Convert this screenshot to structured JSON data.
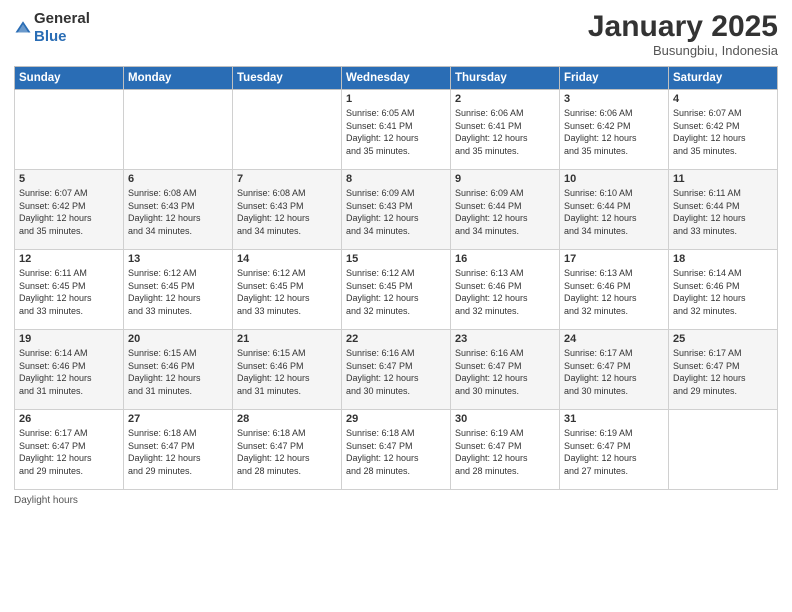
{
  "header": {
    "logo_general": "General",
    "logo_blue": "Blue",
    "month_title": "January 2025",
    "subtitle": "Busungbiu, Indonesia"
  },
  "columns": [
    "Sunday",
    "Monday",
    "Tuesday",
    "Wednesday",
    "Thursday",
    "Friday",
    "Saturday"
  ],
  "weeks": [
    [
      {
        "day": "",
        "info": ""
      },
      {
        "day": "",
        "info": ""
      },
      {
        "day": "",
        "info": ""
      },
      {
        "day": "1",
        "info": "Sunrise: 6:05 AM\nSunset: 6:41 PM\nDaylight: 12 hours\nand 35 minutes."
      },
      {
        "day": "2",
        "info": "Sunrise: 6:06 AM\nSunset: 6:41 PM\nDaylight: 12 hours\nand 35 minutes."
      },
      {
        "day": "3",
        "info": "Sunrise: 6:06 AM\nSunset: 6:42 PM\nDaylight: 12 hours\nand 35 minutes."
      },
      {
        "day": "4",
        "info": "Sunrise: 6:07 AM\nSunset: 6:42 PM\nDaylight: 12 hours\nand 35 minutes."
      }
    ],
    [
      {
        "day": "5",
        "info": "Sunrise: 6:07 AM\nSunset: 6:42 PM\nDaylight: 12 hours\nand 35 minutes."
      },
      {
        "day": "6",
        "info": "Sunrise: 6:08 AM\nSunset: 6:43 PM\nDaylight: 12 hours\nand 34 minutes."
      },
      {
        "day": "7",
        "info": "Sunrise: 6:08 AM\nSunset: 6:43 PM\nDaylight: 12 hours\nand 34 minutes."
      },
      {
        "day": "8",
        "info": "Sunrise: 6:09 AM\nSunset: 6:43 PM\nDaylight: 12 hours\nand 34 minutes."
      },
      {
        "day": "9",
        "info": "Sunrise: 6:09 AM\nSunset: 6:44 PM\nDaylight: 12 hours\nand 34 minutes."
      },
      {
        "day": "10",
        "info": "Sunrise: 6:10 AM\nSunset: 6:44 PM\nDaylight: 12 hours\nand 34 minutes."
      },
      {
        "day": "11",
        "info": "Sunrise: 6:11 AM\nSunset: 6:44 PM\nDaylight: 12 hours\nand 33 minutes."
      }
    ],
    [
      {
        "day": "12",
        "info": "Sunrise: 6:11 AM\nSunset: 6:45 PM\nDaylight: 12 hours\nand 33 minutes."
      },
      {
        "day": "13",
        "info": "Sunrise: 6:12 AM\nSunset: 6:45 PM\nDaylight: 12 hours\nand 33 minutes."
      },
      {
        "day": "14",
        "info": "Sunrise: 6:12 AM\nSunset: 6:45 PM\nDaylight: 12 hours\nand 33 minutes."
      },
      {
        "day": "15",
        "info": "Sunrise: 6:12 AM\nSunset: 6:45 PM\nDaylight: 12 hours\nand 32 minutes."
      },
      {
        "day": "16",
        "info": "Sunrise: 6:13 AM\nSunset: 6:46 PM\nDaylight: 12 hours\nand 32 minutes."
      },
      {
        "day": "17",
        "info": "Sunrise: 6:13 AM\nSunset: 6:46 PM\nDaylight: 12 hours\nand 32 minutes."
      },
      {
        "day": "18",
        "info": "Sunrise: 6:14 AM\nSunset: 6:46 PM\nDaylight: 12 hours\nand 32 minutes."
      }
    ],
    [
      {
        "day": "19",
        "info": "Sunrise: 6:14 AM\nSunset: 6:46 PM\nDaylight: 12 hours\nand 31 minutes."
      },
      {
        "day": "20",
        "info": "Sunrise: 6:15 AM\nSunset: 6:46 PM\nDaylight: 12 hours\nand 31 minutes."
      },
      {
        "day": "21",
        "info": "Sunrise: 6:15 AM\nSunset: 6:46 PM\nDaylight: 12 hours\nand 31 minutes."
      },
      {
        "day": "22",
        "info": "Sunrise: 6:16 AM\nSunset: 6:47 PM\nDaylight: 12 hours\nand 30 minutes."
      },
      {
        "day": "23",
        "info": "Sunrise: 6:16 AM\nSunset: 6:47 PM\nDaylight: 12 hours\nand 30 minutes."
      },
      {
        "day": "24",
        "info": "Sunrise: 6:17 AM\nSunset: 6:47 PM\nDaylight: 12 hours\nand 30 minutes."
      },
      {
        "day": "25",
        "info": "Sunrise: 6:17 AM\nSunset: 6:47 PM\nDaylight: 12 hours\nand 29 minutes."
      }
    ],
    [
      {
        "day": "26",
        "info": "Sunrise: 6:17 AM\nSunset: 6:47 PM\nDaylight: 12 hours\nand 29 minutes."
      },
      {
        "day": "27",
        "info": "Sunrise: 6:18 AM\nSunset: 6:47 PM\nDaylight: 12 hours\nand 29 minutes."
      },
      {
        "day": "28",
        "info": "Sunrise: 6:18 AM\nSunset: 6:47 PM\nDaylight: 12 hours\nand 28 minutes."
      },
      {
        "day": "29",
        "info": "Sunrise: 6:18 AM\nSunset: 6:47 PM\nDaylight: 12 hours\nand 28 minutes."
      },
      {
        "day": "30",
        "info": "Sunrise: 6:19 AM\nSunset: 6:47 PM\nDaylight: 12 hours\nand 28 minutes."
      },
      {
        "day": "31",
        "info": "Sunrise: 6:19 AM\nSunset: 6:47 PM\nDaylight: 12 hours\nand 27 minutes."
      },
      {
        "day": "",
        "info": ""
      }
    ]
  ],
  "footer": {
    "daylight_label": "Daylight hours"
  }
}
